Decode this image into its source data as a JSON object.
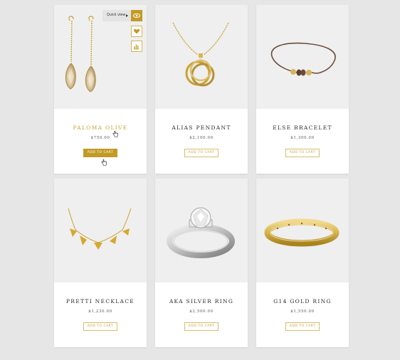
{
  "products": [
    {
      "name": "PALOMA OLIVE",
      "price": "$750.00",
      "button": "ADD TO CART"
    },
    {
      "name": "ALIAS PENDANT",
      "price": "$2,100.00",
      "button": "ADD TO CART"
    },
    {
      "name": "ELSE BRACELET",
      "price": "$1,300.00",
      "button": "ADD TO CART"
    },
    {
      "name": "PRETTI NECKLACE",
      "price": "$1,230.00",
      "button": "ADD TO CART"
    },
    {
      "name": "AKA SILVER RING",
      "price": "$2,500.00",
      "button": "ADD TO CART"
    },
    {
      "name": "G14 GOLD RING",
      "price": "$1,550.00",
      "button": "ADD TO CART"
    }
  ],
  "quick_view": {
    "label": "Quick view"
  },
  "icons": {
    "quick_view": "eye-icon",
    "wishlist": "heart-icon",
    "compare": "bar-chart-icon",
    "cursor": "hand-pointer-icon"
  },
  "colors": {
    "accent": "#c29b26",
    "accent_text": "#c9a233",
    "background": "#e6e6e6",
    "image_bg": "#efefef",
    "card_bg": "#ffffff"
  }
}
